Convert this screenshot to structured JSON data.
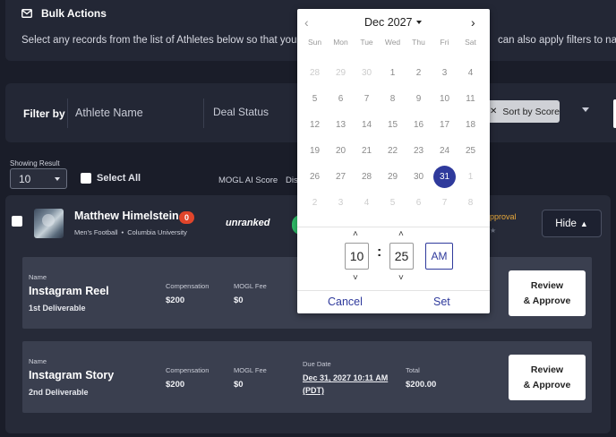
{
  "bulk_actions": {
    "title": "Bulk Actions",
    "description_left": "Select any records from the list of Athletes below so that you can e",
    "description_right": "can also apply filters to narrow"
  },
  "filter": {
    "label": "Filter by",
    "athlete_placeholder": "Athlete Name",
    "deal_status": "Deal Status",
    "sort_chip": "Sort by Score"
  },
  "list": {
    "showing_label": "Showing Result",
    "count_value": "10",
    "select_all": "Select All",
    "col_score": "MOGL AI Score",
    "col_dis": "Dis"
  },
  "athlete": {
    "name": "Matthew Himelstein",
    "badge": "0",
    "sport": "Men's Football",
    "school": "Columbia University",
    "rank": "unranked",
    "status": "pproval",
    "hide_label": "Hide"
  },
  "deliverables": [
    {
      "name_label": "Name",
      "name": "Instagram Reel",
      "sub": "1st Deliverable",
      "comp_label": "Compensation",
      "comp": "$200",
      "fee_label": "MOGL Fee",
      "fee": "$0",
      "review_line1": "Review",
      "review_line2": "& Approve"
    },
    {
      "name_label": "Name",
      "name": "Instagram Story",
      "sub": "2nd Deliverable",
      "comp_label": "Compensation",
      "comp": "$200",
      "fee_label": "MOGL Fee",
      "fee": "$0",
      "due_label": "Due Date",
      "due": "Dec 31, 2027 10:11 AM (PDT)",
      "total_label": "Total",
      "total": "$200.00",
      "review_line1": "Review",
      "review_line2": "& Approve"
    }
  ],
  "calendar": {
    "month": "Dec 2027",
    "weekdays": [
      "Sun",
      "Mon",
      "Tue",
      "Wed",
      "Thu",
      "Fri",
      "Sat"
    ],
    "weeks": [
      [
        "28",
        "29",
        "30",
        "1",
        "2",
        "3",
        "4"
      ],
      [
        "5",
        "6",
        "7",
        "8",
        "9",
        "10",
        "11"
      ],
      [
        "12",
        "13",
        "14",
        "15",
        "16",
        "17",
        "18"
      ],
      [
        "19",
        "20",
        "21",
        "22",
        "23",
        "24",
        "25"
      ],
      [
        "26",
        "27",
        "28",
        "29",
        "30",
        "31",
        "1"
      ],
      [
        "2",
        "3",
        "4",
        "5",
        "6",
        "7",
        "8"
      ]
    ],
    "selected_day": "31",
    "hour": "10",
    "minute": "25",
    "ampm": "AM",
    "cancel_label": "Cancel",
    "set_label": "Set",
    "accent_color": "#2f3a9c"
  }
}
